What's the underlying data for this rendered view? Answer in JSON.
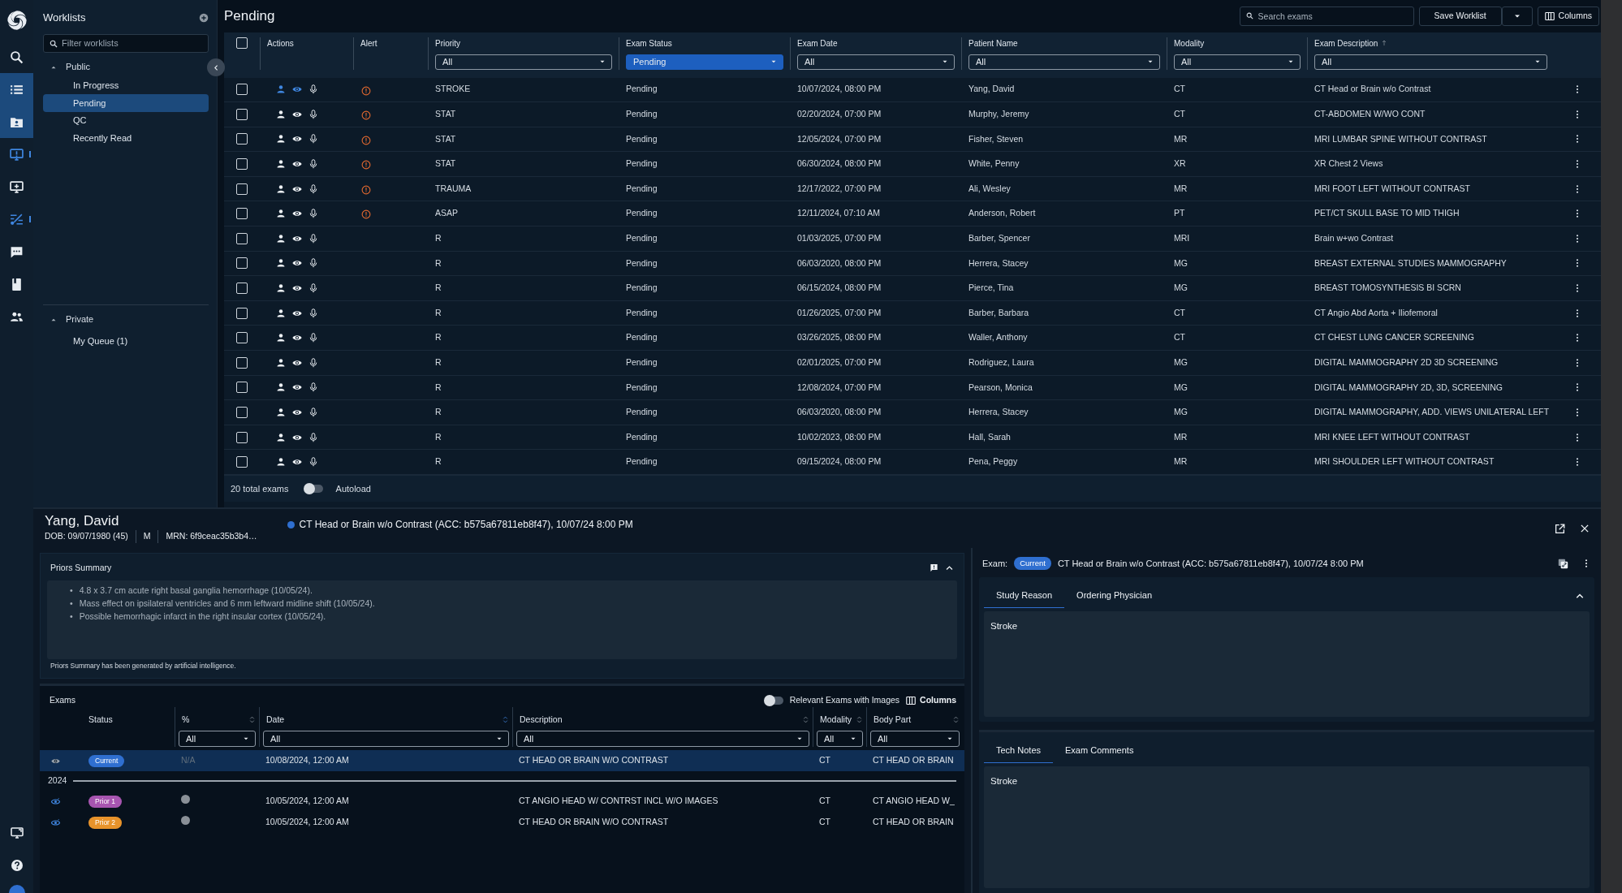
{
  "rail": {
    "items": [
      {
        "selected": false,
        "indicator": false
      },
      {
        "selected": true,
        "indicator": false
      },
      {
        "selected": true,
        "indicator": false
      },
      {
        "selected": false,
        "indicator": true
      },
      {
        "selected": false,
        "indicator": false
      },
      {
        "selected": false,
        "indicator": true
      },
      {
        "selected": false,
        "indicator": false
      },
      {
        "selected": false,
        "indicator": false
      },
      {
        "selected": false,
        "indicator": false
      }
    ]
  },
  "worklists": {
    "title": "Worklists",
    "filter_placeholder": "Filter worklists",
    "groups": [
      {
        "label": "Public",
        "expanded": true,
        "items": [
          {
            "label": "In Progress",
            "selected": false
          },
          {
            "label": "Pending",
            "selected": true
          },
          {
            "label": "QC",
            "selected": false
          },
          {
            "label": "Recently Read",
            "selected": false
          }
        ]
      },
      {
        "label": "Private",
        "expanded": true,
        "items": [
          {
            "label": "My Queue (1)",
            "selected": false
          }
        ]
      }
    ]
  },
  "header": {
    "title": "Pending",
    "search_placeholder": "Search exams",
    "save_button": "Save Worklist",
    "columns_button": "Columns"
  },
  "table": {
    "select_all_checked": false,
    "fixed_columns": [
      {
        "label": "Actions"
      },
      {
        "label": "Alert"
      }
    ],
    "columns": [
      {
        "label": "Priority",
        "filter": "All",
        "filter_active": false
      },
      {
        "label": "Exam Status",
        "filter": "Pending",
        "filter_active": true
      },
      {
        "label": "Exam Date",
        "filter": "All",
        "filter_active": false
      },
      {
        "label": "Patient Name",
        "filter": "All",
        "filter_active": false
      },
      {
        "label": "Modality",
        "filter": "All",
        "filter_active": false
      },
      {
        "label": "Exam Description",
        "filter": "All",
        "filter_active": false,
        "sorted": true
      }
    ],
    "rows": [
      {
        "checked": false,
        "selected": true,
        "alert": true,
        "cells": [
          "STROKE",
          "Pending",
          "10/07/2024, 08:00 PM",
          "Yang, David",
          "CT",
          "CT Head or Brain w/o Contrast"
        ]
      },
      {
        "checked": false,
        "selected": false,
        "alert": true,
        "cells": [
          "STAT",
          "Pending",
          "02/20/2024, 07:00 PM",
          "Murphy, Jeremy",
          "CT",
          "CT-ABDOMEN W/WO CONT"
        ]
      },
      {
        "checked": false,
        "selected": false,
        "alert": true,
        "cells": [
          "STAT",
          "Pending",
          "12/05/2024, 07:00 PM",
          "Fisher, Steven",
          "MR",
          "MRI LUMBAR SPINE WITHOUT CONTRAST"
        ]
      },
      {
        "checked": false,
        "selected": false,
        "alert": true,
        "cells": [
          "STAT",
          "Pending",
          "06/30/2024, 08:00 PM",
          "White, Penny",
          "XR",
          "XR Chest 2 Views"
        ]
      },
      {
        "checked": false,
        "selected": false,
        "alert": true,
        "cells": [
          "TRAUMA",
          "Pending",
          "12/17/2022, 07:00 PM",
          "Ali, Wesley",
          "MR",
          "MRI FOOT LEFT WITHOUT CONTRAST"
        ]
      },
      {
        "checked": false,
        "selected": false,
        "alert": true,
        "cells": [
          "ASAP",
          "Pending",
          "12/11/2024, 07:10 AM",
          "Anderson, Robert",
          "PT",
          "PET/CT SKULL BASE TO MID THIGH"
        ]
      },
      {
        "checked": false,
        "selected": false,
        "alert": false,
        "cells": [
          "R",
          "Pending",
          "01/03/2025, 07:00 PM",
          "Barber, Spencer",
          "MRI",
          "Brain w+wo Contrast"
        ]
      },
      {
        "checked": false,
        "selected": false,
        "alert": false,
        "cells": [
          "R",
          "Pending",
          "06/03/2020, 08:00 PM",
          "Herrera, Stacey",
          "MG",
          "BREAST EXTERNAL STUDIES MAMMOGRAPHY"
        ]
      },
      {
        "checked": false,
        "selected": false,
        "alert": false,
        "cells": [
          "R",
          "Pending",
          "06/15/2024, 08:00 PM",
          "Pierce, Tina",
          "MG",
          "BREAST TOMOSYNTHESIS BI SCRN"
        ]
      },
      {
        "checked": false,
        "selected": false,
        "alert": false,
        "cells": [
          "R",
          "Pending",
          "01/26/2025, 07:00 PM",
          "Barber, Barbara",
          "CT",
          "CT Angio Abd Aorta + Iliofemoral"
        ]
      },
      {
        "checked": false,
        "selected": false,
        "alert": false,
        "cells": [
          "R",
          "Pending",
          "03/26/2025, 08:00 PM",
          "Waller, Anthony",
          "CT",
          "CT CHEST LUNG CANCER SCREENING"
        ]
      },
      {
        "checked": false,
        "selected": false,
        "alert": false,
        "cells": [
          "R",
          "Pending",
          "02/01/2025, 07:00 PM",
          "Rodriguez, Laura",
          "MG",
          "DIGITAL MAMMOGRAPHY 2D 3D SCREENING"
        ]
      },
      {
        "checked": false,
        "selected": false,
        "alert": false,
        "cells": [
          "R",
          "Pending",
          "12/08/2024, 07:00 PM",
          "Pearson, Monica",
          "MG",
          "DIGITAL MAMMOGRAPHY 2D, 3D, SCREENING"
        ]
      },
      {
        "checked": false,
        "selected": false,
        "alert": false,
        "cells": [
          "R",
          "Pending",
          "06/03/2020, 08:00 PM",
          "Herrera, Stacey",
          "MG",
          "DIGITAL MAMMOGRAPHY, ADD. VIEWS UNILATERAL LEFT"
        ]
      },
      {
        "checked": false,
        "selected": false,
        "alert": false,
        "cells": [
          "R",
          "Pending",
          "10/02/2023, 08:00 PM",
          "Hall, Sarah",
          "MR",
          "MRI KNEE LEFT WITHOUT CONTRAST"
        ]
      },
      {
        "checked": false,
        "selected": false,
        "alert": false,
        "cells": [
          "R",
          "Pending",
          "09/15/2024, 08:00 PM",
          "Pena, Peggy",
          "MR",
          "MRI SHOULDER LEFT WITHOUT CONTRAST"
        ]
      }
    ]
  },
  "footer": {
    "total": "20 total exams",
    "autoload_label": "Autoload",
    "autoload_on": false
  },
  "patient": {
    "name": "Yang, David",
    "dob": "DOB: 09/07/1980 (45)",
    "sex": "M",
    "mrn": "MRN: 6f9ceac35b3b4…",
    "exam": "CT Head or Brain w/o Contrast (ACC: b575a67811eb8f47), 10/07/24 8:00 PM"
  },
  "priors": {
    "title": "Priors Summary",
    "expanded": true,
    "bullets": [
      {
        "marker": "•",
        "text": "4.8 x 3.7 cm acute right basal ganglia hemorrhage (10/05/24)."
      },
      {
        "marker": "•",
        "text": "Mass effect on ipsilateral ventricles and 6 mm leftward midline shift (10/05/24)."
      },
      {
        "marker": "•",
        "text": "Possible hemorrhagic infarct in the right insular cortex (10/05/24)."
      }
    ],
    "note": "Priors Summary has been generated by artificial intelligence."
  },
  "exams": {
    "title": "Exams",
    "toggle_label": "Relevant Exams with Images",
    "toggle_on": false,
    "columns_button": "Columns",
    "columns": [
      {
        "label": "Status"
      },
      {
        "label": "%",
        "filter": "All",
        "sorted": false
      },
      {
        "label": "Date",
        "filter": "All",
        "sorted": true
      },
      {
        "label": "Description",
        "filter": "All",
        "sorted": false
      },
      {
        "label": "Modality",
        "filter": "All",
        "sorted": false
      },
      {
        "label": "Body Part",
        "filter": "All",
        "sorted": false
      }
    ],
    "rows": [
      {
        "kind": "exam",
        "selected": true,
        "status": "Current",
        "color": "#2f6fd0",
        "percent": "N/A",
        "date": "10/08/2024, 12:00 AM",
        "description": "CT HEAD OR BRAIN W/O CONTRAST",
        "modality": "CT",
        "body_part": "CT HEAD OR BRAIN"
      },
      {
        "kind": "group",
        "label": "2024"
      },
      {
        "kind": "exam",
        "selected": false,
        "status": "Prior 1",
        "color": "#a755b0",
        "date": "10/05/2024, 12:00 AM",
        "description": "CT ANGIO HEAD W/ CONTRST INCL W/O IMAGES",
        "modality": "CT",
        "body_part": "CT ANGIO HEAD W_"
      },
      {
        "kind": "exam",
        "selected": false,
        "status": "Prior 2",
        "color": "#e8932b",
        "date": "10/05/2024, 12:00 AM",
        "description": "CT HEAD OR BRAIN W/O CONTRAST",
        "modality": "CT",
        "body_part": "CT HEAD OR BRAIN"
      }
    ]
  },
  "detail": {
    "exam_label": "Exam:",
    "badge": "Current",
    "exam": "CT Head or Brain w/o Contrast (ACC: b575a67811eb8f47), 10/07/24 8:00 PM",
    "panels": [
      {
        "expanded": true,
        "tabs": [
          {
            "label": "Study Reason",
            "selected": true
          },
          {
            "label": "Ordering Physician",
            "selected": false
          }
        ],
        "content": "Stroke"
      },
      {
        "tabs": [
          {
            "label": "Tech Notes",
            "selected": true
          },
          {
            "label": "Exam Comments",
            "selected": false
          }
        ],
        "content": "Stroke"
      }
    ]
  }
}
